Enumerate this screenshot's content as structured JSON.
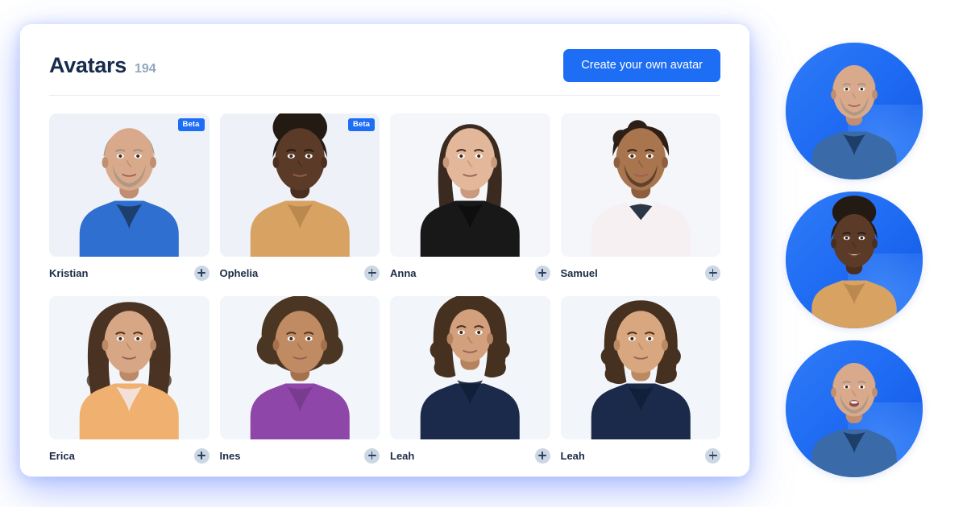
{
  "header": {
    "title": "Avatars",
    "count": "194",
    "create_button_label": "Create your own avatar"
  },
  "badges": {
    "beta_label": "Beta"
  },
  "colors": {
    "accent_blue": "#1d6ef5",
    "title_navy": "#172b4d",
    "count_grey": "#94a6be",
    "card_bg": "#eef2f8",
    "add_circle": "#ccd7e4",
    "divider": "#e8edf3"
  },
  "avatars": [
    {
      "name": "Kristian",
      "beta": true,
      "add_icon": "plus-circle-icon",
      "appearance": {
        "skin": "#d9a98b",
        "skin_shadow": "#c08f72",
        "hair": "#9c9388",
        "hair_style": "short-balding",
        "facial_hair": "#8d8a84",
        "clothing": "#2f6fd0",
        "clothing_dark": "#1c3a63",
        "bg": "#eef2f8"
      }
    },
    {
      "name": "Ophelia",
      "beta": true,
      "add_icon": "plus-circle-icon",
      "appearance": {
        "skin": "#5b3a28",
        "skin_shadow": "#4a2e1f",
        "hair": "#241a14",
        "hair_style": "afro-updo",
        "facial_hair": "",
        "clothing": "#d8a263",
        "clothing_dark": "#b8854b",
        "bg": "#eef2f8"
      }
    },
    {
      "name": "Anna",
      "beta": false,
      "add_icon": "plus-circle-icon",
      "appearance": {
        "skin": "#e3b79a",
        "skin_shadow": "#cb9a7c",
        "hair": "#3b2a20",
        "hair_style": "long-straight-dark",
        "facial_hair": "",
        "clothing": "#181818",
        "clothing_dark": "#0d0d0d",
        "bg": "#f4f6fa"
      }
    },
    {
      "name": "Samuel",
      "beta": false,
      "add_icon": "plus-circle-icon",
      "appearance": {
        "skin": "#a9754f",
        "skin_shadow": "#8e5f3f",
        "hair": "#2e1f16",
        "hair_style": "short-curly",
        "facial_hair": "#241811",
        "clothing": "#f6f0f2",
        "clothing_dark": "#2b3646",
        "bg": "#f4f6fa"
      }
    },
    {
      "name": "Erica",
      "beta": false,
      "add_icon": "plus-circle-icon",
      "appearance": {
        "skin": "#d7a684",
        "skin_shadow": "#bd8a68",
        "hair": "#4a3323",
        "hair_style": "long-curly",
        "facial_hair": "",
        "clothing": "#f0b070",
        "clothing_dark": "#f3e7e4",
        "bg": "#f2f5f9"
      }
    },
    {
      "name": "Ines",
      "beta": false,
      "add_icon": "plus-circle-icon",
      "appearance": {
        "skin": "#c08a63",
        "skin_shadow": "#a4714e",
        "hair": "#4b3623",
        "hair_style": "afro",
        "facial_hair": "",
        "clothing": "#8e46a8",
        "clothing_dark": "#753a8c",
        "bg": "#f2f5f9"
      }
    },
    {
      "name": "Leah",
      "beta": false,
      "add_icon": "plus-circle-icon",
      "appearance": {
        "skin": "#d2a07c",
        "skin_shadow": "#b6835f",
        "hair": "#46301f",
        "hair_style": "medium-curly",
        "facial_hair": "",
        "clothing": "#1b2a4a",
        "clothing_dark": "#121e38",
        "bg": "#f2f5f9"
      }
    },
    {
      "name": "Leah",
      "beta": false,
      "add_icon": "plus-circle-icon",
      "appearance": {
        "skin": "#d8a77f",
        "skin_shadow": "#bb8a62",
        "hair": "#46301f",
        "hair_style": "medium-curly",
        "facial_hair": "",
        "clothing": "#1b2a4a",
        "clothing_dark": "#121e38",
        "bg": "#f2f5f9"
      }
    }
  ],
  "circle_avatars": [
    {
      "name": "Kristian",
      "expression": "neutral",
      "appearance": {
        "skin": "#d9a98b",
        "skin_shadow": "#c08f72",
        "hair": "#9c9388",
        "facial_hair": "#8d8a84",
        "clothing": "#3a6ba8",
        "clothing_dark": "#1c3a63",
        "bg": "#1d6ef5"
      }
    },
    {
      "name": "Ophelia",
      "expression": "smiling",
      "appearance": {
        "skin": "#5b3a28",
        "skin_shadow": "#4a2e1f",
        "hair": "#241a14",
        "facial_hair": "",
        "clothing": "#d8a263",
        "clothing_dark": "#b8854b",
        "bg": "#1d6ef5"
      }
    },
    {
      "name": "Kristian",
      "expression": "talking",
      "appearance": {
        "skin": "#d9a98b",
        "skin_shadow": "#c08f72",
        "hair": "#9c9388",
        "facial_hair": "#8d8a84",
        "clothing": "#3a6ba8",
        "clothing_dark": "#1c3a63",
        "bg": "#1d6ef5"
      }
    }
  ]
}
